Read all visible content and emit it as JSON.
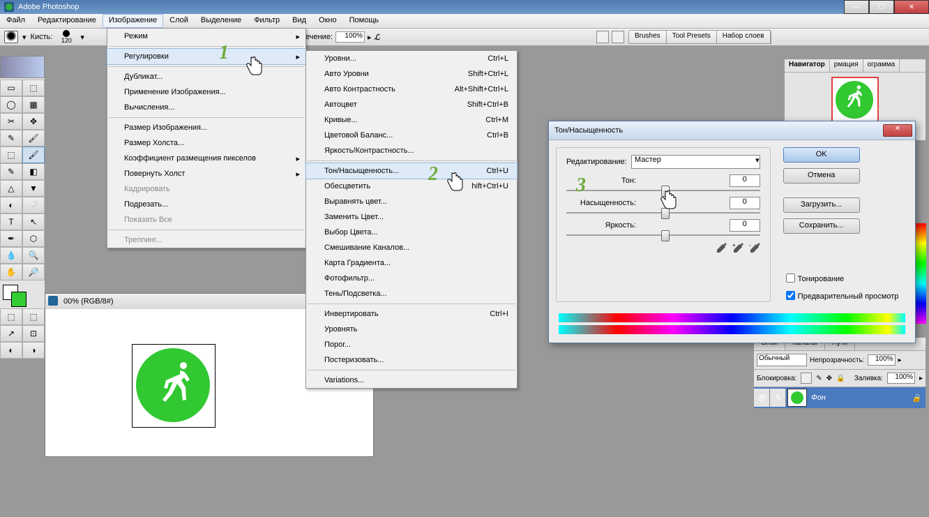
{
  "title": "Adobe Photoshop",
  "menubar": [
    "Файл",
    "Редактирование",
    "Изображение",
    "Слой",
    "Выделение",
    "Фильтр",
    "Вид",
    "Окно",
    "Помощь"
  ],
  "menubar_hl_index": 2,
  "optbar": {
    "brush_label": "Кисть:",
    "brush_size": "120",
    "flow_label": "ечение:",
    "flow_val": "100%"
  },
  "palette_tabs": [
    "Brushes",
    "Tool Presets",
    "Набор слоев"
  ],
  "menu1": [
    {
      "type": "item",
      "label": "Режим",
      "arrow": true
    },
    {
      "type": "sep"
    },
    {
      "type": "item",
      "label": "Регулировки",
      "arrow": true,
      "hl": true
    },
    {
      "type": "sep"
    },
    {
      "type": "item",
      "label": "Дубликат..."
    },
    {
      "type": "item",
      "label": "Применение Изображения..."
    },
    {
      "type": "item",
      "label": "Вычисления..."
    },
    {
      "type": "sep"
    },
    {
      "type": "item",
      "label": "Размер Изображения..."
    },
    {
      "type": "item",
      "label": "Размер Холста..."
    },
    {
      "type": "item",
      "label": "Коэффициент размещения пикселов",
      "arrow": true
    },
    {
      "type": "item",
      "label": "Повернуть Холст",
      "arrow": true
    },
    {
      "type": "item",
      "label": "Кадрировать",
      "dis": true
    },
    {
      "type": "item",
      "label": "Подрезать..."
    },
    {
      "type": "item",
      "label": "Показать Все",
      "dis": true
    },
    {
      "type": "sep"
    },
    {
      "type": "item",
      "label": "Треппинг...",
      "dis": true
    }
  ],
  "menu2": [
    {
      "type": "item",
      "label": "Уровни...",
      "short": "Ctrl+L"
    },
    {
      "type": "item",
      "label": "Авто Уровни",
      "short": "Shift+Ctrl+L"
    },
    {
      "type": "item",
      "label": "Авто Контрастность",
      "short": "Alt+Shift+Ctrl+L"
    },
    {
      "type": "item",
      "label": "Автоцвет",
      "short": "Shift+Ctrl+B"
    },
    {
      "type": "item",
      "label": "Кривые...",
      "short": "Ctrl+M"
    },
    {
      "type": "item",
      "label": "Цветовой Баланс...",
      "short": "Ctrl+B"
    },
    {
      "type": "item",
      "label": "Яркость/Контрастность..."
    },
    {
      "type": "sep"
    },
    {
      "type": "item",
      "label": "Тон/Насыщенность...",
      "short": "Ctrl+U",
      "hl": true
    },
    {
      "type": "item",
      "label": "Обесцветить",
      "short": "hift+Ctrl+U"
    },
    {
      "type": "item",
      "label": "Выравнять цвет..."
    },
    {
      "type": "item",
      "label": "Заменить Цвет..."
    },
    {
      "type": "item",
      "label": "Выбор Цвета..."
    },
    {
      "type": "item",
      "label": "Смешивание Каналов..."
    },
    {
      "type": "item",
      "label": "Карта Градиента..."
    },
    {
      "type": "item",
      "label": "Фотофильтр..."
    },
    {
      "type": "item",
      "label": "Тень/Подсветка..."
    },
    {
      "type": "sep"
    },
    {
      "type": "item",
      "label": "Инвертировать",
      "short": "Ctrl+I"
    },
    {
      "type": "item",
      "label": "Уровнять"
    },
    {
      "type": "item",
      "label": "Порог..."
    },
    {
      "type": "item",
      "label": "Постеризовать..."
    },
    {
      "type": "sep"
    },
    {
      "type": "item",
      "label": "Variations..."
    }
  ],
  "steps": {
    "s1": "1",
    "s2": "2",
    "s3": "3"
  },
  "dialog": {
    "title": "Тон/Насыщенность",
    "edit_label": "Редактирование:",
    "edit_value": "Мастер",
    "sliders": [
      {
        "label": "Тон:",
        "val": "0"
      },
      {
        "label": "Насыщенность:",
        "val": "0"
      },
      {
        "label": "Яркость:",
        "val": "0"
      }
    ],
    "ok": "OK",
    "cancel": "Отмена",
    "load": "Загрузить...",
    "save": "Сохранить...",
    "colorize": "Тонирование",
    "preview": "Предварительный просмотр"
  },
  "doc": {
    "title": "00% (RGB/8#)"
  },
  "nav_tabs": [
    "Навигатор",
    "рмация",
    "ограмма"
  ],
  "layers": {
    "tabs": [
      "Слои",
      "Каналы",
      "Пути"
    ],
    "mode": "Обычный",
    "opacity_label": "Непрозрачность:",
    "opacity": "100% ",
    "lock_label": "Блокировка:",
    "fill_label": "Заливка:",
    "fill": "100% ",
    "layer_name": "Фон"
  }
}
